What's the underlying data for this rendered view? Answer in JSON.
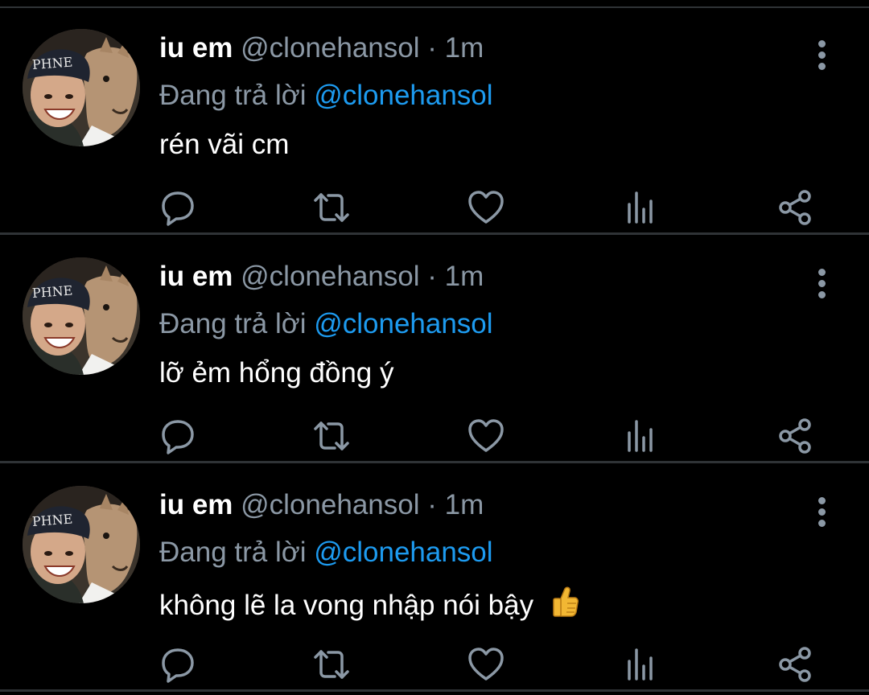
{
  "colors": {
    "background": "#000000",
    "divider": "#2f3336",
    "text_primary": "#ffffff",
    "text_secondary": "#8b98a5",
    "accent": "#1d9bf0"
  },
  "tweets": [
    {
      "display_name": "iu em",
      "handle": "@clonehansol",
      "separator": "·",
      "time": "1m",
      "reply_prefix": "Đang trả lời",
      "reply_to": "@clonehansol",
      "text": "rén vãi cm"
    },
    {
      "display_name": "iu em",
      "handle": "@clonehansol",
      "separator": "·",
      "time": "1m",
      "reply_prefix": "Đang trả lời",
      "reply_to": "@clonehansol",
      "text": "lỡ ẻm hổng đồng ý"
    },
    {
      "display_name": "iu em",
      "handle": "@clonehansol",
      "separator": "·",
      "time": "1m",
      "reply_prefix": "Đang trả lời",
      "reply_to": "@clonehansol",
      "text": "không lẽ la vong nhập nói bậy",
      "emoji": "thumbs-up-emoji"
    }
  ],
  "action_icons": [
    "reply-icon",
    "retweet-icon",
    "like-icon",
    "analytics-icon",
    "share-icon"
  ],
  "menu_icon": "more-vertical-icon"
}
